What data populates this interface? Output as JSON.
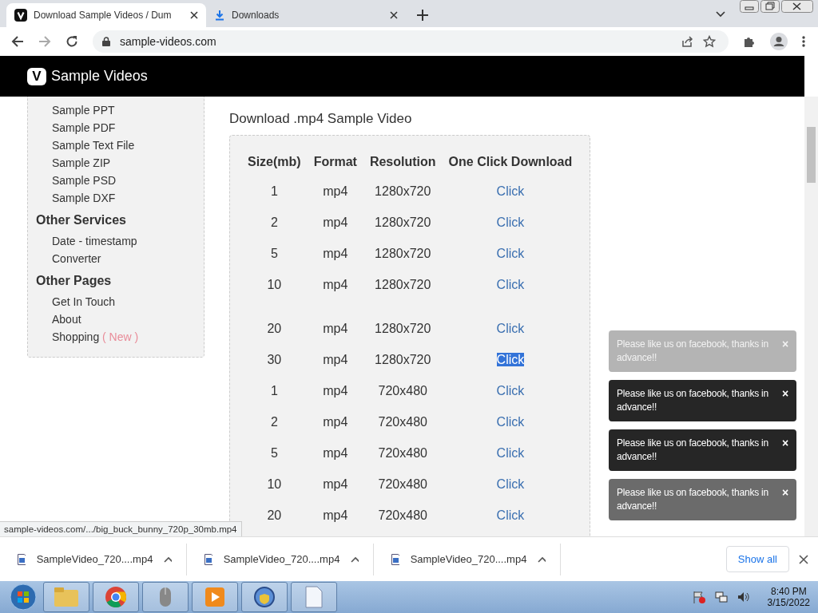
{
  "browser": {
    "tabs": [
      {
        "title": "Download Sample Videos / Dum",
        "kind": "site",
        "selected": true
      },
      {
        "title": "Downloads",
        "kind": "download",
        "selected": false
      }
    ],
    "address": "sample-videos.com"
  },
  "site": {
    "logo_letter": "V",
    "name": "Sample Videos"
  },
  "sidebar": {
    "groups": [
      {
        "items": [
          {
            "label": "Sample PPT"
          },
          {
            "label": "Sample PDF"
          },
          {
            "label": "Sample Text File"
          },
          {
            "label": "Sample ZIP"
          },
          {
            "label": "Sample PSD"
          },
          {
            "label": "Sample DXF"
          }
        ]
      },
      {
        "heading": "Other Services",
        "items": [
          {
            "label": "Date - timestamp"
          },
          {
            "label": "Converter"
          }
        ]
      },
      {
        "heading": "Other Pages",
        "items": [
          {
            "label": "Get In Touch"
          },
          {
            "label": "About"
          },
          {
            "label": "Shopping",
            "badge": "( New )"
          }
        ]
      }
    ]
  },
  "main": {
    "heading": "Download .mp4 Sample Video",
    "table": {
      "columns": [
        "Size(mb)",
        "Format",
        "Resolution",
        "One Click Download"
      ],
      "rows": [
        {
          "size": "1",
          "format": "mp4",
          "resolution": "1280x720",
          "link": "Click",
          "selected": false
        },
        {
          "size": "2",
          "format": "mp4",
          "resolution": "1280x720",
          "link": "Click",
          "selected": false
        },
        {
          "size": "5",
          "format": "mp4",
          "resolution": "1280x720",
          "link": "Click",
          "selected": false
        },
        {
          "size": "10",
          "format": "mp4",
          "resolution": "1280x720",
          "link": "Click",
          "selected": false
        },
        {
          "size": "20",
          "format": "mp4",
          "resolution": "1280x720",
          "link": "Click",
          "selected": false
        },
        {
          "size": "30",
          "format": "mp4",
          "resolution": "1280x720",
          "link": "Click",
          "selected": true
        },
        {
          "size": "1",
          "format": "mp4",
          "resolution": "720x480",
          "link": "Click",
          "selected": false
        },
        {
          "size": "2",
          "format": "mp4",
          "resolution": "720x480",
          "link": "Click",
          "selected": false
        },
        {
          "size": "5",
          "format": "mp4",
          "resolution": "720x480",
          "link": "Click",
          "selected": false
        },
        {
          "size": "10",
          "format": "mp4",
          "resolution": "720x480",
          "link": "Click",
          "selected": false
        },
        {
          "size": "20",
          "format": "mp4",
          "resolution": "720x480",
          "link": "Click",
          "selected": false
        }
      ]
    }
  },
  "toasts": [
    {
      "text": "Please like us on facebook, thanks in advance!!",
      "close": "×",
      "kind": "fading"
    },
    {
      "text": "Please like us on facebook, thanks in advance!!",
      "close": "×",
      "kind": "solid"
    },
    {
      "text": "Please like us on facebook, thanks in advance!!",
      "close": "×",
      "kind": "solid"
    },
    {
      "text": "Please like us on facebook, thanks in advance!!",
      "close": "×",
      "kind": "dimmed"
    }
  ],
  "status_url": "sample-videos.com/.../big_buck_bunny_720p_30mb.mp4",
  "downloads": {
    "items": [
      {
        "name": "SampleVideo_720....mp4"
      },
      {
        "name": "SampleVideo_720....mp4"
      },
      {
        "name": "SampleVideo_720....mp4"
      }
    ],
    "show_all": "Show all"
  },
  "taskbar": {
    "time": "8:40 PM",
    "date": "3/15/2022"
  }
}
